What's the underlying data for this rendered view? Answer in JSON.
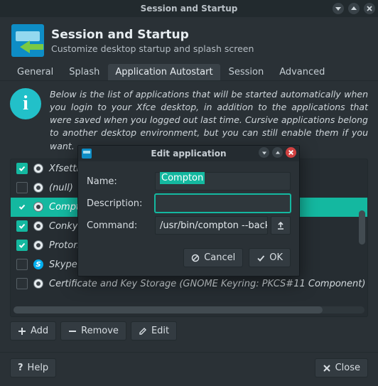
{
  "window": {
    "title": "Session and Startup"
  },
  "header": {
    "title": "Session and Startup",
    "subtitle": "Customize desktop startup and splash screen"
  },
  "tabs": {
    "items": [
      {
        "label": "General"
      },
      {
        "label": "Splash"
      },
      {
        "label": "Application Autostart"
      },
      {
        "label": "Session"
      },
      {
        "label": "Advanced"
      }
    ],
    "active": 2
  },
  "info_text": "Below is the list of applications that will be started automatically when you login to your Xfce desktop, in addition to the applications that were saved when you logged out last time. Cursive applications belong to another desktop environment, but you can still enable them if you want.",
  "rows": [
    {
      "checked": true,
      "label": "Xfsettingsd"
    },
    {
      "checked": false,
      "label": "(null)"
    },
    {
      "checked": true,
      "label": "Compton",
      "selected": true
    },
    {
      "checked": true,
      "label": "Conky"
    },
    {
      "checked": true,
      "label": "Proton"
    },
    {
      "checked": false,
      "label": "Skype",
      "icon": "skype"
    },
    {
      "checked": false,
      "label": "Certificate and Key Storage (GNOME Keyring: PKCS#11 Component)"
    }
  ],
  "toolbar": {
    "add": "Add",
    "remove": "Remove",
    "edit": "Edit"
  },
  "footer": {
    "help": "Help",
    "close": "Close"
  },
  "modal": {
    "title": "Edit application",
    "name_label": "Name:",
    "name_value": "Compton",
    "desc_label": "Description:",
    "desc_value": "",
    "cmd_label": "Command:",
    "cmd_value": "/usr/bin/compton --back",
    "cancel": "Cancel",
    "ok": "OK"
  }
}
